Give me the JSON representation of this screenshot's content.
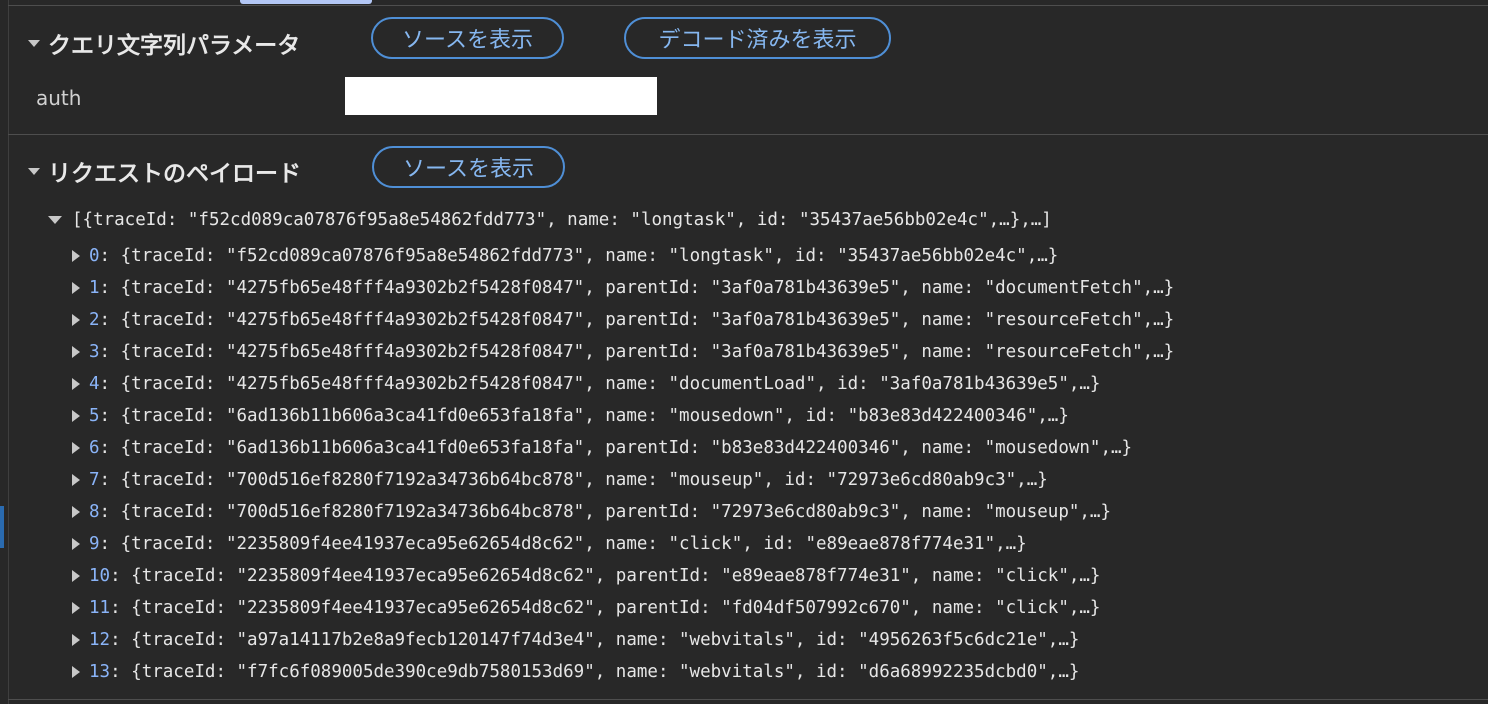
{
  "query_section": {
    "title": "クエリ文字列パラメータ",
    "view_source_label": "ソースを表示",
    "view_decoded_label": "デコード済みを表示",
    "params": [
      {
        "name": "auth",
        "value": ""
      }
    ]
  },
  "payload_section": {
    "title": "リクエストのペイロード",
    "view_source_label": "ソースを表示",
    "root_summary": "[{traceId: \"f52cd089ca07876f95a8e54862fdd773\", name: \"longtask\", id: \"35437ae56bb02e4c\",…},…]",
    "items": [
      {
        "index": "0",
        "summary": "{traceId: \"f52cd089ca07876f95a8e54862fdd773\", name: \"longtask\", id: \"35437ae56bb02e4c\",…}"
      },
      {
        "index": "1",
        "summary": "{traceId: \"4275fb65e48fff4a9302b2f5428f0847\", parentId: \"3af0a781b43639e5\", name: \"documentFetch\",…}"
      },
      {
        "index": "2",
        "summary": "{traceId: \"4275fb65e48fff4a9302b2f5428f0847\", parentId: \"3af0a781b43639e5\", name: \"resourceFetch\",…}"
      },
      {
        "index": "3",
        "summary": "{traceId: \"4275fb65e48fff4a9302b2f5428f0847\", parentId: \"3af0a781b43639e5\", name: \"resourceFetch\",…}"
      },
      {
        "index": "4",
        "summary": "{traceId: \"4275fb65e48fff4a9302b2f5428f0847\", name: \"documentLoad\", id: \"3af0a781b43639e5\",…}"
      },
      {
        "index": "5",
        "summary": "{traceId: \"6ad136b11b606a3ca41fd0e653fa18fa\", name: \"mousedown\", id: \"b83e83d422400346\",…}"
      },
      {
        "index": "6",
        "summary": "{traceId: \"6ad136b11b606a3ca41fd0e653fa18fa\", parentId: \"b83e83d422400346\", name: \"mousedown\",…}"
      },
      {
        "index": "7",
        "summary": "{traceId: \"700d516ef8280f7192a34736b64bc878\", name: \"mouseup\", id: \"72973e6cd80ab9c3\",…}"
      },
      {
        "index": "8",
        "summary": "{traceId: \"700d516ef8280f7192a34736b64bc878\", parentId: \"72973e6cd80ab9c3\", name: \"mouseup\",…}"
      },
      {
        "index": "9",
        "summary": "{traceId: \"2235809f4ee41937eca95e62654d8c62\", name: \"click\", id: \"e89eae878f774e31\",…}"
      },
      {
        "index": "10",
        "summary": "{traceId: \"2235809f4ee41937eca95e62654d8c62\", parentId: \"e89eae878f774e31\", name: \"click\",…}"
      },
      {
        "index": "11",
        "summary": "{traceId: \"2235809f4ee41937eca95e62654d8c62\", parentId: \"fd04df507992c670\", name: \"click\",…}"
      },
      {
        "index": "12",
        "summary": "{traceId: \"a97a14117b2e8a9fecb120147f74d3e4\", name: \"webvitals\", id: \"4956263f5c6dc21e\",…}"
      },
      {
        "index": "13",
        "summary": "{traceId: \"f7fc6f089005de390ce9db7580153d69\", name: \"webvitals\", id: \"d6a68992235dcbd0\",…}"
      }
    ]
  }
}
